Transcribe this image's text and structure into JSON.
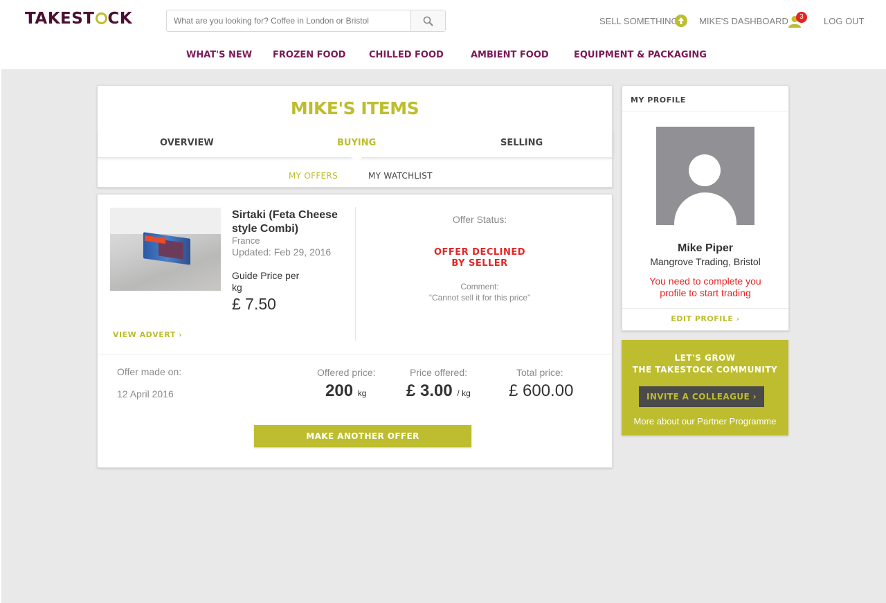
{
  "header": {
    "logo_prefix": "TAKEST",
    "logo_suffix": "CK",
    "search_placeholder": "What are you looking for? Coffee in London or Bristol",
    "sell_label": "SELL SOMETHING",
    "dashboard_label": "MIKE'S DASHBOARD",
    "notification_count": "3",
    "logout_label": "LOG OUT"
  },
  "nav": {
    "items": [
      "WHAT'S NEW",
      "FROZEN FOOD",
      "CHILLED FOOD",
      "AMBIENT FOOD",
      "EQUIPMENT & PACKAGING"
    ]
  },
  "items_panel": {
    "title": "MIKE'S ITEMS",
    "tabs": [
      "OVERVIEW",
      "BUYING",
      "SELLING"
    ],
    "active_tab": "BUYING",
    "subtabs": [
      "MY OFFERS",
      "MY WATCHLIST"
    ],
    "active_subtab": "MY OFFERS"
  },
  "offer": {
    "product_name": "Sirtaki (Feta Cheese style Combi)",
    "origin": "France",
    "updated": "Updated: Feb 29, 2016",
    "guide_label": "Guide Price per kg",
    "guide_price": "£ 7.50",
    "view_advert": "VIEW ADVERT",
    "status_label": "Offer Status:",
    "status_line1": "OFFER DECLINED",
    "status_line2": "BY SELLER",
    "comment_label": "Comment:",
    "comment_text": "“Cannot sell it for this price”",
    "offer_made_label": "Offer made on:",
    "offer_made_date": "12 April 2016",
    "offered_qty_label": "Offered price:",
    "offered_qty_value": "200",
    "offered_qty_unit": "kg",
    "price_offered_label": "Price offered:",
    "price_offered_value": "£ 3.00",
    "price_offered_unit": "/ kg",
    "total_label": "Total price:",
    "total_value": "£ 600.00",
    "make_offer_label": "MAKE ANOTHER OFFER"
  },
  "profile": {
    "heading": "MY PROFILE",
    "name": "Mike Piper",
    "company": "Mangrove Trading, Bristol",
    "warning": "You need to complete you profile to start trading",
    "edit_label": "EDIT PROFILE"
  },
  "community": {
    "title_line1": "LET'S GROW",
    "title_line2": "THE TAKESTOCK COMMUNITY",
    "invite_label": "INVITE A COLLEAGUE",
    "partner_link": "More about our Partner Programme"
  },
  "colors": {
    "brand_purple": "#4a1034",
    "nav_purple": "#7a1a57",
    "accent_olive": "#bdbd2f",
    "alert_red": "#e52424",
    "background_grey": "#e9e9ea"
  },
  "icons": [
    "search-icon",
    "upload-icon",
    "user-icon",
    "chevron-right-icon",
    "avatar-placeholder-icon"
  ]
}
